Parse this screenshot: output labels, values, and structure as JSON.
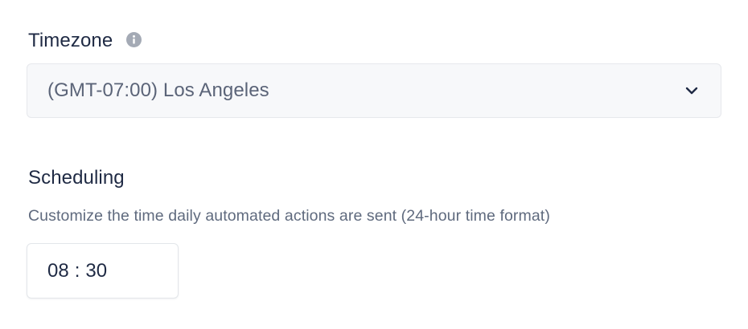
{
  "timezone": {
    "label": "Timezone",
    "info_icon": "info-icon",
    "selected_value": "(GMT-07:00) Los Angeles",
    "dropdown_icon": "chevron-down-icon"
  },
  "scheduling": {
    "title": "Scheduling",
    "description": "Customize the time daily automated actions are sent (24-hour time format)",
    "time": {
      "hours": "08",
      "separator": ":",
      "minutes": "30"
    }
  },
  "colors": {
    "text_primary": "#1f2a44",
    "text_secondary": "#5f6a7e",
    "select_background": "#f7f8fa",
    "border": "#e6e8ec",
    "info_icon": "#a4aab5"
  }
}
